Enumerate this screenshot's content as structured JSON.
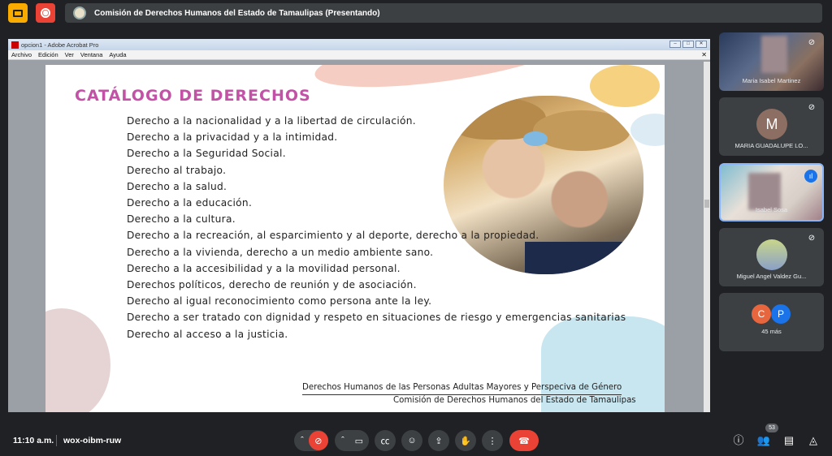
{
  "topbar": {
    "presentation_title": "Comisión de Derechos Humanos del Estado de Tamaulipas (Presentando)"
  },
  "acrobat": {
    "window_title": "opcion1 - Adobe Acrobat Pro",
    "menu": [
      "Archivo",
      "Edición",
      "Ver",
      "Ventana",
      "Ayuda"
    ]
  },
  "slide": {
    "title": "CATÁLOGO DE DERECHOS",
    "rights": [
      "Derecho a la nacionalidad y a la libertad de circulación.",
      "Derecho a la privacidad y a la intimidad.",
      "Derecho a la Seguridad Social.",
      "Derecho al trabajo.",
      "Derecho a la salud.",
      "Derecho a la educación.",
      "Derecho a la cultura.",
      "Derecho a la recreación, al esparcimiento y al deporte, derecho a la propiedad.",
      "Derecho a la vivienda, derecho a un medio ambiente sano.",
      "Derecho a la accesibilidad y a la movilidad personal.",
      "Derechos políticos, derecho de reunión y de asociación.",
      "Derecho al igual reconocimiento como persona ante la ley.",
      "Derecho a ser tratado con dignidad y respeto en situaciones de riesgo y emergencias sanitarias",
      "Derecho al acceso a la justicia."
    ],
    "footer_line1": "Derechos Humanos de las Personas Adultas Mayores y Perspeciva de Género",
    "footer_line2": "Comisión de Derechos Humanos del Estado de Tamaulipas"
  },
  "participants": {
    "tile1_name": "Maria Isabel Martinez",
    "tile2_initial": "M",
    "tile2_name": "MARIA GUADALUPE LO...",
    "tile3_name": "Isabel   Sosa",
    "tile4_name": "Miguel Angel Valdez Gu...",
    "tile5_initials": [
      "C",
      "P"
    ],
    "tile5_more": "45 más"
  },
  "bottom": {
    "time": "11:10 a.m.",
    "meeting_code": "wox-oibm-ruw",
    "participants_count": "53"
  },
  "colors": {
    "accent_red": "#ea4335",
    "title_purple": "#c352a6",
    "active_blue": "#8ab4f8"
  }
}
